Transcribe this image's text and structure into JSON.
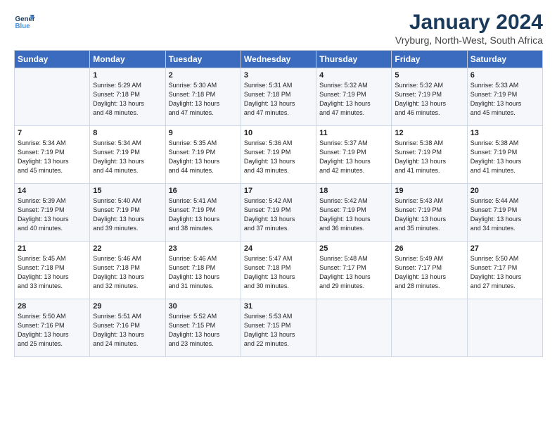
{
  "header": {
    "logo_line1": "General",
    "logo_line2": "Blue",
    "title": "January 2024",
    "subtitle": "Vryburg, North-West, South Africa"
  },
  "columns": [
    "Sunday",
    "Monday",
    "Tuesday",
    "Wednesday",
    "Thursday",
    "Friday",
    "Saturday"
  ],
  "weeks": [
    [
      {
        "day": "",
        "info": ""
      },
      {
        "day": "1",
        "info": "Sunrise: 5:29 AM\nSunset: 7:18 PM\nDaylight: 13 hours\nand 48 minutes."
      },
      {
        "day": "2",
        "info": "Sunrise: 5:30 AM\nSunset: 7:18 PM\nDaylight: 13 hours\nand 47 minutes."
      },
      {
        "day": "3",
        "info": "Sunrise: 5:31 AM\nSunset: 7:18 PM\nDaylight: 13 hours\nand 47 minutes."
      },
      {
        "day": "4",
        "info": "Sunrise: 5:32 AM\nSunset: 7:19 PM\nDaylight: 13 hours\nand 47 minutes."
      },
      {
        "day": "5",
        "info": "Sunrise: 5:32 AM\nSunset: 7:19 PM\nDaylight: 13 hours\nand 46 minutes."
      },
      {
        "day": "6",
        "info": "Sunrise: 5:33 AM\nSunset: 7:19 PM\nDaylight: 13 hours\nand 45 minutes."
      }
    ],
    [
      {
        "day": "7",
        "info": "Sunrise: 5:34 AM\nSunset: 7:19 PM\nDaylight: 13 hours\nand 45 minutes."
      },
      {
        "day": "8",
        "info": "Sunrise: 5:34 AM\nSunset: 7:19 PM\nDaylight: 13 hours\nand 44 minutes."
      },
      {
        "day": "9",
        "info": "Sunrise: 5:35 AM\nSunset: 7:19 PM\nDaylight: 13 hours\nand 44 minutes."
      },
      {
        "day": "10",
        "info": "Sunrise: 5:36 AM\nSunset: 7:19 PM\nDaylight: 13 hours\nand 43 minutes."
      },
      {
        "day": "11",
        "info": "Sunrise: 5:37 AM\nSunset: 7:19 PM\nDaylight: 13 hours\nand 42 minutes."
      },
      {
        "day": "12",
        "info": "Sunrise: 5:38 AM\nSunset: 7:19 PM\nDaylight: 13 hours\nand 41 minutes."
      },
      {
        "day": "13",
        "info": "Sunrise: 5:38 AM\nSunset: 7:19 PM\nDaylight: 13 hours\nand 41 minutes."
      }
    ],
    [
      {
        "day": "14",
        "info": "Sunrise: 5:39 AM\nSunset: 7:19 PM\nDaylight: 13 hours\nand 40 minutes."
      },
      {
        "day": "15",
        "info": "Sunrise: 5:40 AM\nSunset: 7:19 PM\nDaylight: 13 hours\nand 39 minutes."
      },
      {
        "day": "16",
        "info": "Sunrise: 5:41 AM\nSunset: 7:19 PM\nDaylight: 13 hours\nand 38 minutes."
      },
      {
        "day": "17",
        "info": "Sunrise: 5:42 AM\nSunset: 7:19 PM\nDaylight: 13 hours\nand 37 minutes."
      },
      {
        "day": "18",
        "info": "Sunrise: 5:42 AM\nSunset: 7:19 PM\nDaylight: 13 hours\nand 36 minutes."
      },
      {
        "day": "19",
        "info": "Sunrise: 5:43 AM\nSunset: 7:19 PM\nDaylight: 13 hours\nand 35 minutes."
      },
      {
        "day": "20",
        "info": "Sunrise: 5:44 AM\nSunset: 7:19 PM\nDaylight: 13 hours\nand 34 minutes."
      }
    ],
    [
      {
        "day": "21",
        "info": "Sunrise: 5:45 AM\nSunset: 7:18 PM\nDaylight: 13 hours\nand 33 minutes."
      },
      {
        "day": "22",
        "info": "Sunrise: 5:46 AM\nSunset: 7:18 PM\nDaylight: 13 hours\nand 32 minutes."
      },
      {
        "day": "23",
        "info": "Sunrise: 5:46 AM\nSunset: 7:18 PM\nDaylight: 13 hours\nand 31 minutes."
      },
      {
        "day": "24",
        "info": "Sunrise: 5:47 AM\nSunset: 7:18 PM\nDaylight: 13 hours\nand 30 minutes."
      },
      {
        "day": "25",
        "info": "Sunrise: 5:48 AM\nSunset: 7:17 PM\nDaylight: 13 hours\nand 29 minutes."
      },
      {
        "day": "26",
        "info": "Sunrise: 5:49 AM\nSunset: 7:17 PM\nDaylight: 13 hours\nand 28 minutes."
      },
      {
        "day": "27",
        "info": "Sunrise: 5:50 AM\nSunset: 7:17 PM\nDaylight: 13 hours\nand 27 minutes."
      }
    ],
    [
      {
        "day": "28",
        "info": "Sunrise: 5:50 AM\nSunset: 7:16 PM\nDaylight: 13 hours\nand 25 minutes."
      },
      {
        "day": "29",
        "info": "Sunrise: 5:51 AM\nSunset: 7:16 PM\nDaylight: 13 hours\nand 24 minutes."
      },
      {
        "day": "30",
        "info": "Sunrise: 5:52 AM\nSunset: 7:15 PM\nDaylight: 13 hours\nand 23 minutes."
      },
      {
        "day": "31",
        "info": "Sunrise: 5:53 AM\nSunset: 7:15 PM\nDaylight: 13 hours\nand 22 minutes."
      },
      {
        "day": "",
        "info": ""
      },
      {
        "day": "",
        "info": ""
      },
      {
        "day": "",
        "info": ""
      }
    ]
  ]
}
